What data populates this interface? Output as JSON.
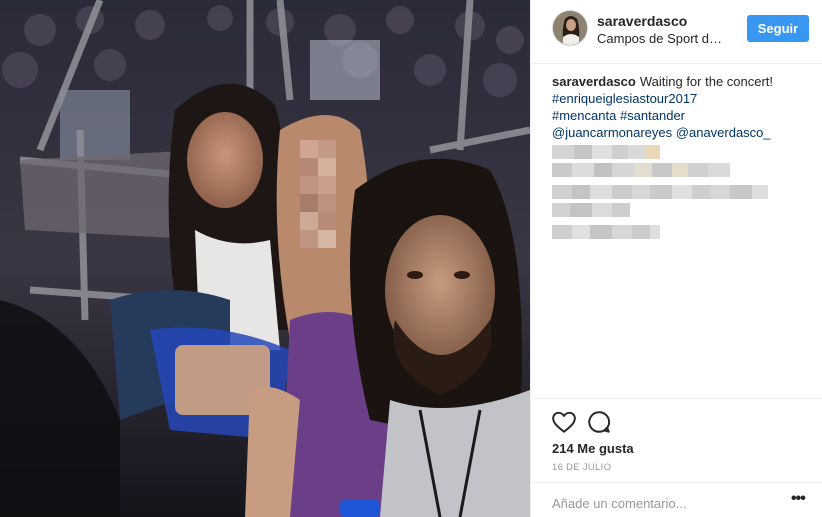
{
  "post": {
    "username": "saraverdasco",
    "location": "Campos de Sport d…",
    "follow_label": "Seguir",
    "caption": {
      "username": "saraverdasco",
      "text": "Waiting for the concert!",
      "tags": [
        "#enriqueiglesiastour2017",
        "#mencanta",
        "#santander",
        "@juancarmonareyes",
        "@anaverdasco_"
      ]
    },
    "likes": "214 Me gusta",
    "date": "16 DE JULIO",
    "comment_placeholder": "Añade un comentario...",
    "more_label": "•••"
  },
  "icons": {
    "avatar": "profile-picture",
    "like": "heart-outline-icon",
    "comment": "speech-bubble-icon",
    "more": "ellipsis-icon"
  },
  "colors": {
    "follow_button": "#3897f0",
    "hashtag": "#003569",
    "muted": "#999999",
    "border": "#efefef"
  }
}
